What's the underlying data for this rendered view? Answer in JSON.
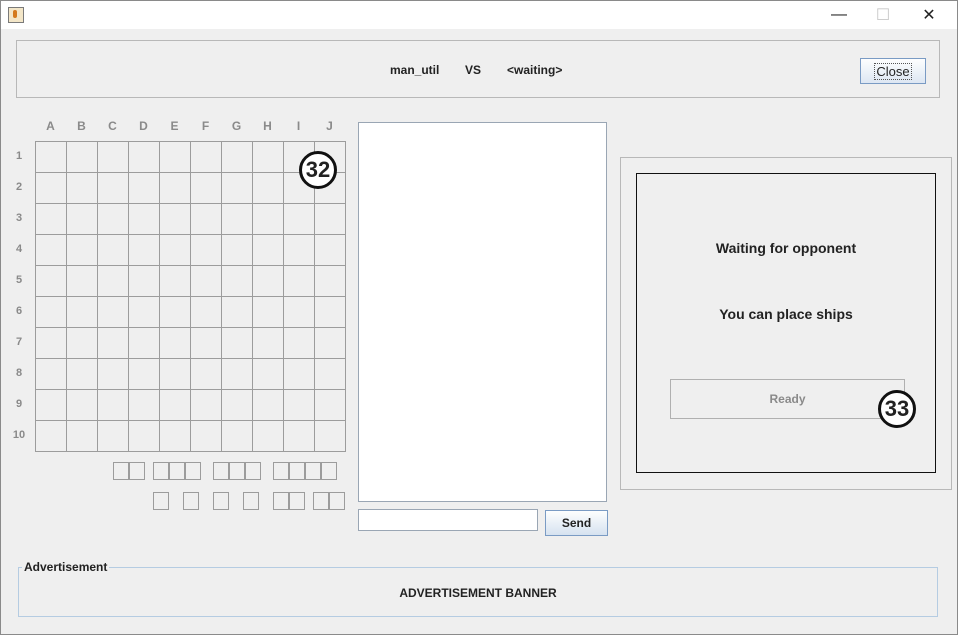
{
  "window": {
    "icon": "java-cup-icon",
    "controls": {
      "minimize": "—",
      "maximize": "☐",
      "close": "✕"
    }
  },
  "header": {
    "player1": "man_util",
    "vs": "VS",
    "player2": "<waiting>",
    "close_label": "Close"
  },
  "board": {
    "columns": [
      "A",
      "B",
      "C",
      "D",
      "E",
      "F",
      "G",
      "H",
      "I",
      "J"
    ],
    "rows": [
      "1",
      "2",
      "3",
      "4",
      "5",
      "6",
      "7",
      "8",
      "9",
      "10"
    ],
    "marker": "32"
  },
  "chat": {
    "input_value": "",
    "send_label": "Send"
  },
  "status": {
    "line1": "Waiting for opponent",
    "line2": "You can place ships",
    "ready_label": "Ready",
    "marker": "33"
  },
  "advertisement": {
    "title": "Advertisement",
    "banner": "ADVERTISEMENT BANNER"
  }
}
